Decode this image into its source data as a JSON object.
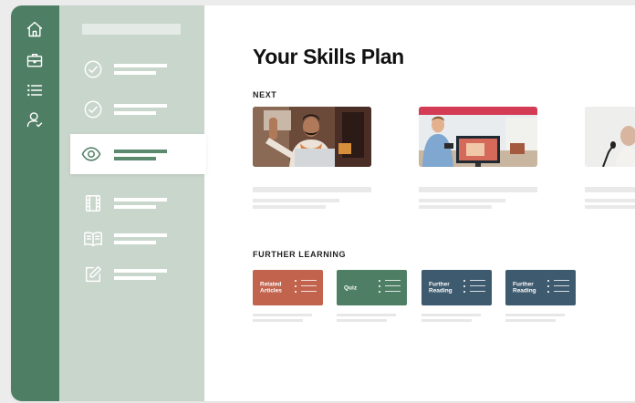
{
  "colors": {
    "rail": "#4e7e63",
    "sidebar": "#c9d6cc",
    "active_accent": "#4e7e63",
    "tile_related": "#c2634e",
    "tile_quiz": "#4e7e63",
    "tile_reading": "#3e5a6e"
  },
  "rail": {
    "icons": [
      "home-icon",
      "briefcase-icon",
      "list-icon",
      "user-check-icon"
    ]
  },
  "sidebar": {
    "items": [
      {
        "icon": "check-circle-icon",
        "active": false
      },
      {
        "icon": "check-circle-icon",
        "active": false
      },
      {
        "icon": "eye-icon",
        "active": true
      },
      {
        "icon": "film-icon",
        "active": false
      },
      {
        "icon": "book-open-icon",
        "active": false
      },
      {
        "icon": "edit-icon",
        "active": false
      }
    ]
  },
  "main": {
    "title": "Your Skills Plan",
    "next_label": "NEXT",
    "further_label": "FURTHER LEARNING",
    "tiles": [
      {
        "label": "Related Articles",
        "color": "#c2634e"
      },
      {
        "label": "Quiz",
        "color": "#4e7e63"
      },
      {
        "label": "Further Reading",
        "color": "#3e5a6e"
      },
      {
        "label": "Further Reading",
        "color": "#3e5a6e"
      }
    ]
  }
}
